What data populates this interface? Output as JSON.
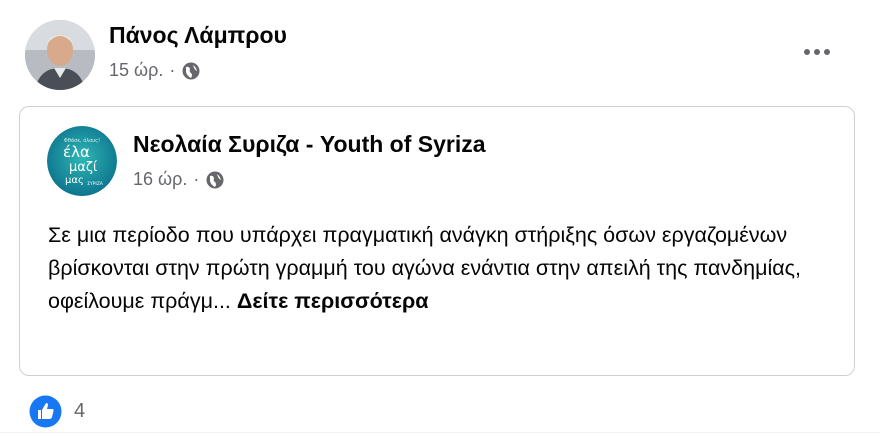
{
  "post": {
    "author": "Πάνος Λάμπρου",
    "time": "15 ώρ.",
    "separator": "·"
  },
  "shared": {
    "page_name": "Νεολαία Συριζα - Youth of Syriza",
    "time": "16 ώρ.",
    "separator": "·",
    "text": "Σε μια περίοδο που υπάρχει πραγματική ανάγκη στήριξης όσων εργαζομένων βρίσκονται στην πρώτη γραμμή του αγώνα ενάντια στην απειλή της πανδημίας, οφείλουμε πράγμ...",
    "see_more": "Δείτε περισσότερα",
    "avatar_text": {
      "small": "Φθάσε, όλους!",
      "line1": "έλα",
      "line2": "μαζί",
      "line3": "μας",
      "logo": "ΣΥΡΙΖΑ"
    }
  },
  "reactions": {
    "count": "4"
  },
  "icons": {
    "globe": "globe-icon",
    "more": "more-options-icon",
    "like": "like-icon"
  },
  "colors": {
    "secondary_text": "#65676b",
    "like_blue": "#1877f2",
    "page_avatar_teal": "#0f8fa0"
  }
}
